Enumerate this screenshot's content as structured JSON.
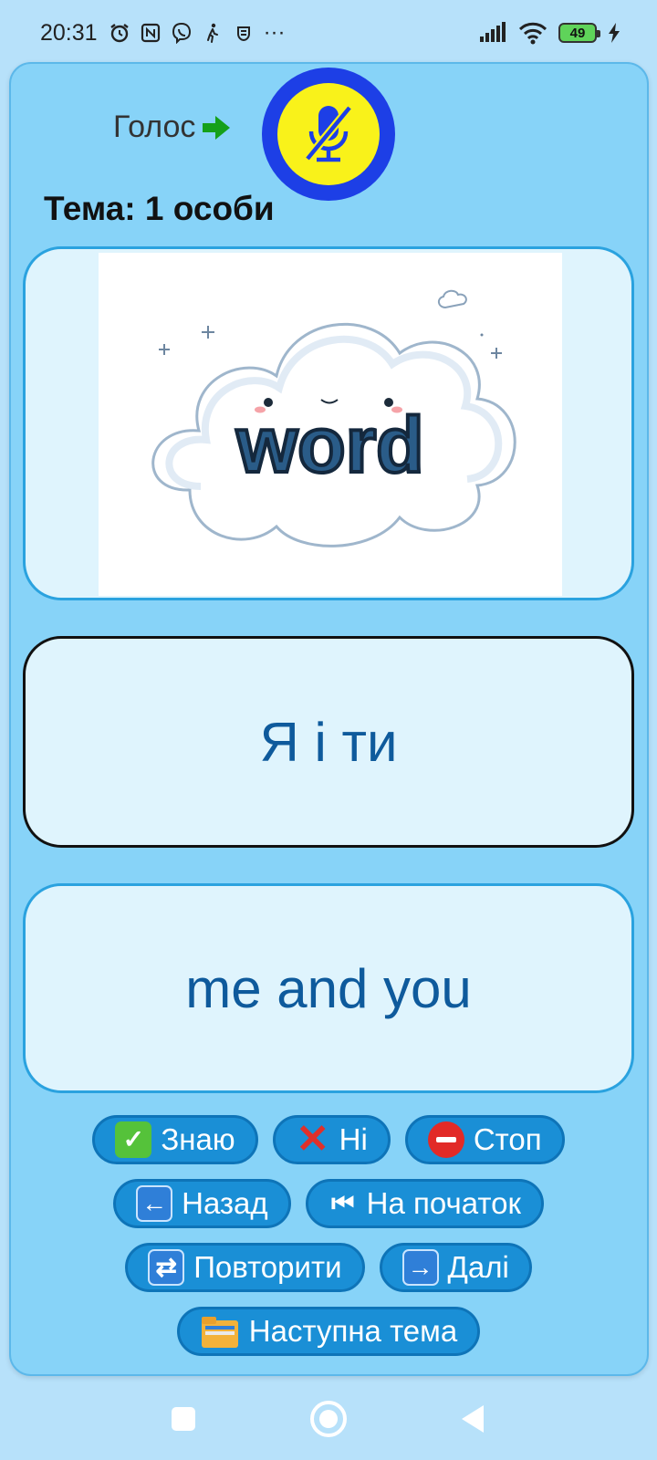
{
  "status_bar": {
    "time": "20:31",
    "more": "···",
    "battery": "49"
  },
  "header": {
    "voice_label": "Голос",
    "topic": "Тема: 1 особи"
  },
  "image_card": {
    "word": "word"
  },
  "cards": {
    "ukrainian": "Я і ти",
    "english": "me and you"
  },
  "buttons": {
    "know": "Знаю",
    "no": "Ні",
    "stop": "Стоп",
    "back": "Назад",
    "to_start": "На початок",
    "repeat": "Повторити",
    "next": "Далі",
    "next_topic": "Наступна тема"
  },
  "colors": {
    "background": "#b7e1fa",
    "card": "#87d3f8",
    "button": "#1a8fd6",
    "mic_outer": "#1d3fe6",
    "mic_inner": "#f9f21a",
    "word_text": "#0e5a9c"
  }
}
